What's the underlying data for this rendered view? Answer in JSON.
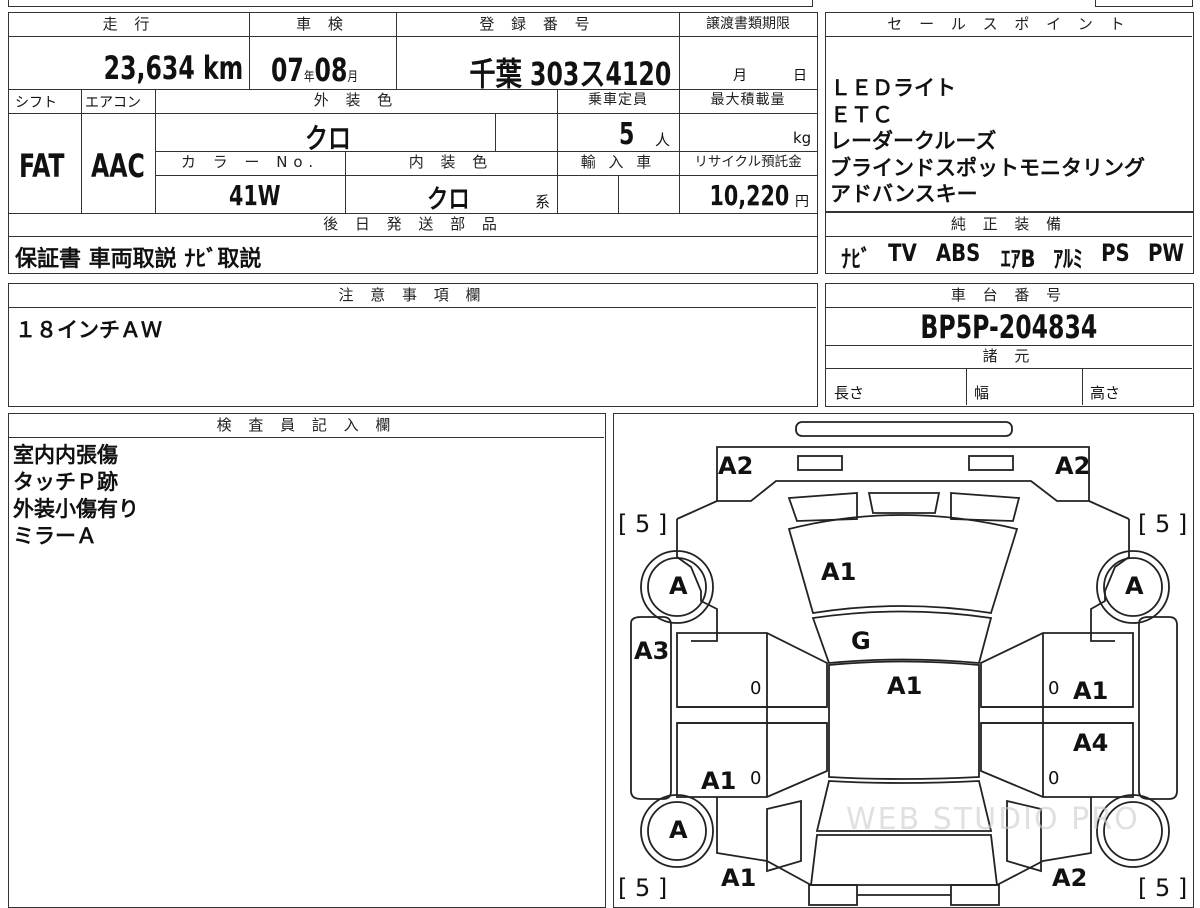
{
  "top_left": {
    "headers": {
      "mileage": "走 行",
      "inspection": "車 検",
      "registration": "登 録 番 号",
      "transfer_deadline": "譲渡書類期限",
      "shift": "シフト",
      "aircon": "エアコン",
      "exterior_color": "外 装 色",
      "capacity": "乗車定員",
      "max_load": "最大積載量",
      "color_no": "カ ラ ー No.",
      "interior_color": "内 装 色",
      "import": "輸 入 車",
      "recycle_fee": "リサイクル預託金"
    },
    "mileage_value": "23,634",
    "mileage_unit": "km",
    "inspection_year": "07",
    "year_unit": "年",
    "inspection_month": "08",
    "month_unit": "月",
    "plate_region": "千葉",
    "plate_number": "303ス4120",
    "deadline_month_unit": "月",
    "deadline_day_unit": "日",
    "shift_value": "FAT",
    "aircon_value": "AAC",
    "exterior_color_value": "クロ",
    "capacity_value": "5",
    "capacity_unit": "人",
    "max_load_unit": "kg",
    "color_no_value": "41W",
    "interior_color_value": "クロ",
    "interior_color_suffix": "系",
    "recycle_value": "10,220",
    "recycle_unit": "円"
  },
  "sales_points": {
    "header": "セ ー ル ス ポ イ ン ト",
    "items": [
      "ＬＥＤライト",
      "ＥＴＣ",
      "レーダークルーズ",
      "ブラインドスポットモニタリング",
      "アドバンスキー"
    ]
  },
  "later_parts": {
    "header": "後 日 発 送 部 品",
    "value": "保証書 車両取説 ﾅﾋﾞ取説"
  },
  "genuine_equipment": {
    "header": "純 正 装 備",
    "items": [
      "ﾅﾋﾞ",
      "TV",
      "ABS",
      "ｴｱB",
      "ｱﾙﾐ",
      "PS",
      "PW"
    ]
  },
  "notes": {
    "header": "注 意 事 項 欄",
    "value": "１８インチＡＷ"
  },
  "chassis": {
    "header": "車 台 番 号",
    "value": "BP5P-204834",
    "spec_header": "諸 元",
    "length": "長さ",
    "width": "幅",
    "height": "高さ"
  },
  "inspector": {
    "header": "検 査 員 記 入 欄",
    "lines": [
      "室内内張傷",
      "タッチＰ跡",
      "外装小傷有り",
      "ミラーＡ"
    ]
  },
  "diagram": {
    "marks": {
      "a2_left": "A2",
      "a2_right": "A2",
      "tire_tl": "[ 5 ]",
      "tire_tr": "[ 5 ]",
      "tire_bl": "[ 5 ]",
      "tire_br": "[ 5 ]",
      "wheel_fl": "A",
      "wheel_fr": "A",
      "wheel_rl": "A",
      "hood": "A1",
      "windshield": "G",
      "roof": "A1",
      "left_fender": "A3",
      "right_door_front": "A1",
      "right_door_rear": "A4",
      "left_rear": "A1",
      "bottom_left": "A1",
      "bottom_right": "A2",
      "zero_1": "0",
      "zero_2": "0",
      "zero_3": "0",
      "zero_4": "0"
    }
  },
  "watermark": "WEB STUDIO PRO"
}
